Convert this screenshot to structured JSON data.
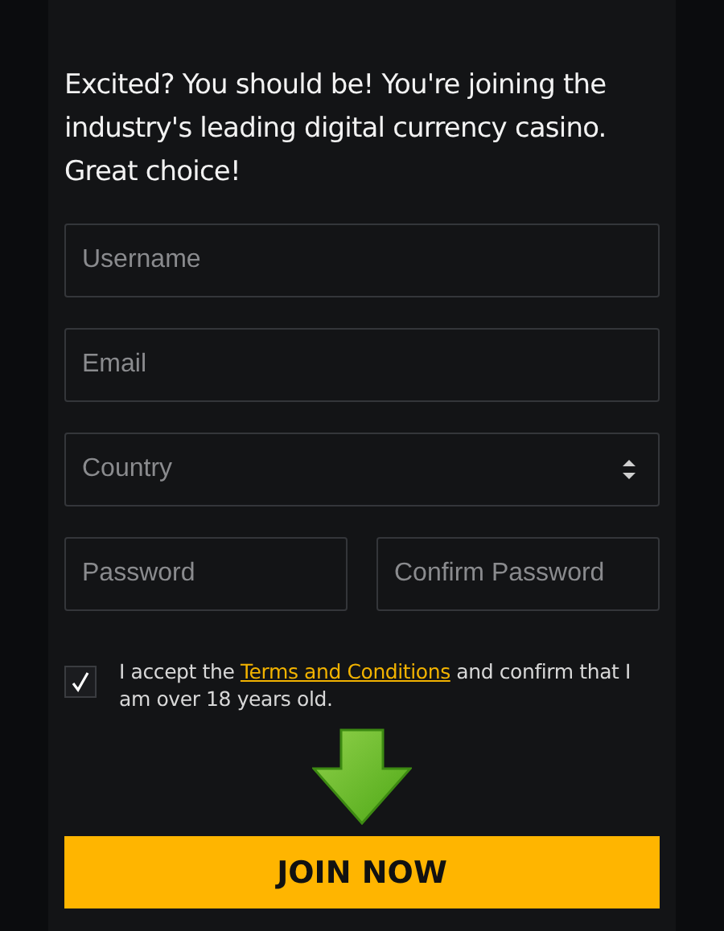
{
  "heading": "Excited? You should be! You're joining the industry's leading digital currency casino. Great choice!",
  "fields": [
    {
      "kind": "text",
      "placeholder": "Username"
    },
    {
      "kind": "text",
      "placeholder": "Email"
    },
    {
      "kind": "select",
      "placeholder": "Country"
    }
  ],
  "password_fields": [
    {
      "placeholder": "Password"
    },
    {
      "placeholder": "Confirm Password"
    }
  ],
  "consent": {
    "checked": true,
    "before": "I accept the ",
    "link": "Terms and Conditions",
    "after": " and confirm that I am over 18 years old."
  },
  "submit": "JOIN NOW"
}
